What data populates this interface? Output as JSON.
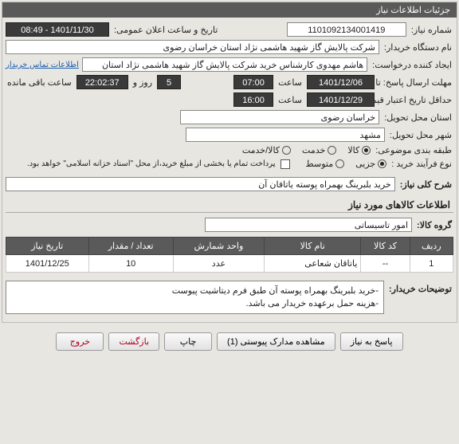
{
  "header": {
    "title": "جزئیات اطلاعات نیاز"
  },
  "fields": {
    "need_no_label": "شماره نیاز:",
    "need_no": "1101092134001419",
    "announce_label": "تاریخ و ساعت اعلان عمومی:",
    "announce_val": "1401/11/30 - 08:49",
    "buyer_org_label": "نام دستگاه خریدار:",
    "buyer_org": "شرکت پالایش گاز شهید هاشمی نژاد   استان خراسان رضوی",
    "requester_label": "ایجاد کننده درخواست:",
    "requester": "هاشم مهدوی کارشناس خرید شرکت پالایش گاز شهید هاشمی نژاد   استان",
    "contact_link": "اطلاعات تماس خریدار",
    "send_deadline_label": "مهلت ارسال پاسخ: تا تاریخ:",
    "send_deadline_date": "1401/12/06",
    "time_label": "ساعت",
    "send_deadline_time": "07:00",
    "day_and_label": "روز و",
    "days": "5",
    "remaining_time": "22:02:37",
    "remaining_label": "ساعت باقی مانده",
    "price_valid_label": "حداقل تاریخ اعتبار قیمت: تا تاریخ:",
    "price_valid_date": "1401/12/29",
    "price_valid_time": "16:00",
    "deliver_province_label": "استان محل تحویل:",
    "deliver_province": "خراسان رضوی",
    "deliver_city_label": "شهر محل تحویل:",
    "deliver_city": "مشهد",
    "category_label": "طبقه بندی موضوعی:",
    "cat_goods": "کالا",
    "cat_service": "خدمت",
    "cat_goods_service": "کالا/خدمت",
    "purchase_type_label": "نوع فرآیند خرید :",
    "pt_small": "جزیی",
    "pt_medium": "متوسط",
    "pay_note": "پرداخت تمام یا بخشی از مبلغ خرید،از محل \"اسناد خزانه اسلامی\" خواهد بود.",
    "need_desc_label": "شرح کلی نیاز:",
    "need_desc": "خرید بلبرینگ بهمراه پوسته یاتاقان آن"
  },
  "items_section": {
    "title": "اطلاعات کالاهای مورد نیاز",
    "group_label": "گروه کالا:",
    "group_val": "امور تاسیساتی"
  },
  "table": {
    "headers": {
      "row": "ردیف",
      "code": "کد کالا",
      "name": "نام کالا",
      "unit": "واحد شمارش",
      "qty": "تعداد / مقدار",
      "date": "تاریخ نیاز"
    },
    "rows": [
      {
        "row": "1",
        "code": "--",
        "name": "یاتاقان شعاعی",
        "unit": "عدد",
        "qty": "10",
        "date": "1401/12/25"
      }
    ]
  },
  "buyer_notes": {
    "label": "توضیحات خریدار:",
    "line1": "-خرید بلبرینگ بهمراه پوسته آن طبق فرم دیتاشیت پیوست",
    "line2": "-هزینه حمل برعهده خریدار می باشد."
  },
  "buttons": {
    "respond": "پاسخ به نیاز",
    "attachments": "مشاهده مدارک پیوستی (1)",
    "print": "چاپ",
    "back": "بازگشت",
    "exit": "خروج"
  }
}
